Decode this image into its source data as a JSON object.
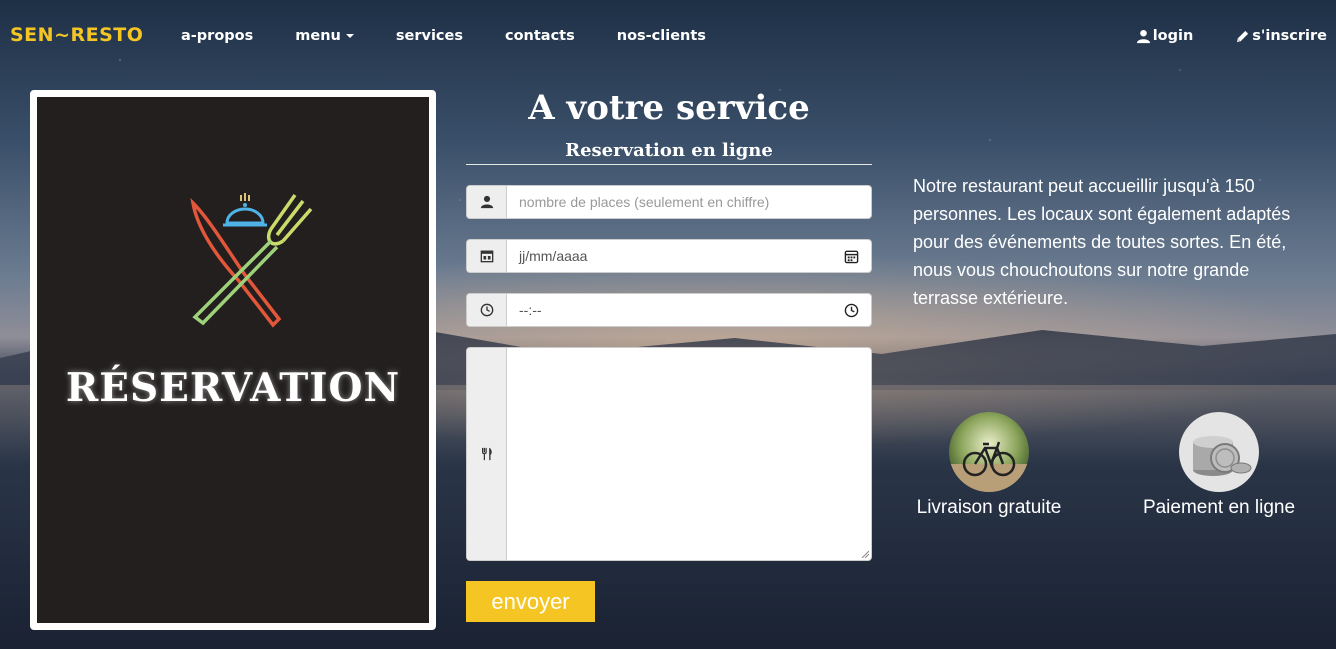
{
  "nav": {
    "brand": "SEN~RESTO",
    "links": [
      "a-propos",
      "menu",
      "services",
      "contacts",
      "nos-clients"
    ],
    "login": "login",
    "signup": "s'inscrire"
  },
  "poster": {
    "title": "RÉSERVATION"
  },
  "form": {
    "title": "A votre service",
    "subtitle": "Reservation en ligne",
    "places_placeholder": "nombre de places (seulement en chiffre)",
    "date_placeholder": "jj/mm/aaaa",
    "time_placeholder": "--:--",
    "submit_label": "envoyer"
  },
  "about": {
    "text": "Notre restaurant peut accueillir jusqu'à 150 personnes. Les locaux sont également adaptés pour des événements de toutes sortes. En été, nous vous chouchoutons sur notre grande terrasse extérieure."
  },
  "features": [
    {
      "label": "Livraison gratuite",
      "icon": "bicycle-icon"
    },
    {
      "label": "Paiement en ligne",
      "icon": "coins-icon"
    }
  ],
  "colors": {
    "accent": "#f5c623",
    "poster_bg": "#221f1e"
  }
}
